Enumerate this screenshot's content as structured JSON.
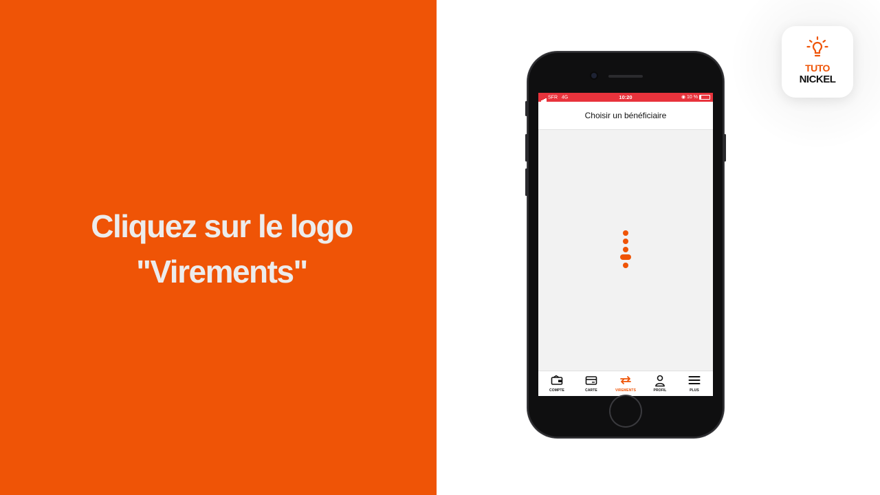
{
  "instruction": {
    "line1": "Cliquez sur le logo",
    "line2": "\"Virements\""
  },
  "brand": {
    "logo_icon": "lightbulb-icon",
    "tuto": "TUTO",
    "nickel": "NICKEL",
    "accent_color": "#ef5406"
  },
  "phone": {
    "status_bar": {
      "carrier": "SFR",
      "network": "4G",
      "time": "10:20",
      "battery": "10 %",
      "color": "#e8333c"
    },
    "screen_title": "Choisir un bénéficiaire",
    "loader": "loading-spinner-icon",
    "tabs": [
      {
        "label": "COMPTE",
        "icon": "wallet-icon",
        "active": false
      },
      {
        "label": "CARTE",
        "icon": "card-icon",
        "active": false
      },
      {
        "label": "VIREMENTS",
        "icon": "transfer-arrows-icon",
        "active": true
      },
      {
        "label": "PROFIL",
        "icon": "user-icon",
        "active": false
      },
      {
        "label": "PLUS",
        "icon": "menu-icon",
        "active": false
      }
    ]
  }
}
